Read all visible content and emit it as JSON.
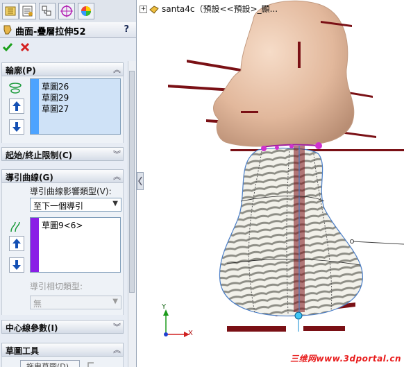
{
  "tabs": [
    {
      "name": "feature-manager",
      "icon": "feature-tree-icon"
    },
    {
      "name": "property-manager",
      "icon": "property-manager-icon"
    },
    {
      "name": "configuration-manager",
      "icon": "configuration-icon"
    },
    {
      "name": "dimxpert-manager",
      "icon": "crosshair-target-icon"
    },
    {
      "name": "display-manager",
      "icon": "appearance-sphere-icon"
    }
  ],
  "panel": {
    "title": "曲面-疊層拉伸52",
    "help": "?",
    "ok_icon": "check-icon",
    "cancel_icon": "close-icon"
  },
  "sections": {
    "profiles": {
      "label": "輪廓(P)",
      "items": [
        "草圖26",
        "草圖29",
        "草圖27"
      ],
      "strip_color": "#4da3ff"
    },
    "start_end": {
      "label": "起始/終止限制(C)"
    },
    "guides": {
      "label": "導引曲線(G)",
      "influence_label": "導引曲線影響類型(V):",
      "influence_value": "至下一個導引",
      "items": [
        "草圖9<6>"
      ],
      "strip_color": "#8a1ee6",
      "tangency_label": "導引相切類型:",
      "tangency_value": "無"
    },
    "centerline": {
      "label": "中心線參數(I)"
    },
    "sketch_tools": {
      "label": "草圖工具",
      "drag_sketch": "拖曳草圖(D)"
    }
  },
  "viewport": {
    "tree_label": "santa4c（預設<<預設>_顯...",
    "triad": {
      "x": "X",
      "y": "Y"
    },
    "watermark": "三维网www.3dportal.cn"
  },
  "colors": {
    "head": "#e6c0a6",
    "spike": "#7a1015",
    "profile_strip": "#4da3ff",
    "guide_strip": "#8a1ee6",
    "ok": "#1aa01a",
    "cancel": "#d42020"
  }
}
